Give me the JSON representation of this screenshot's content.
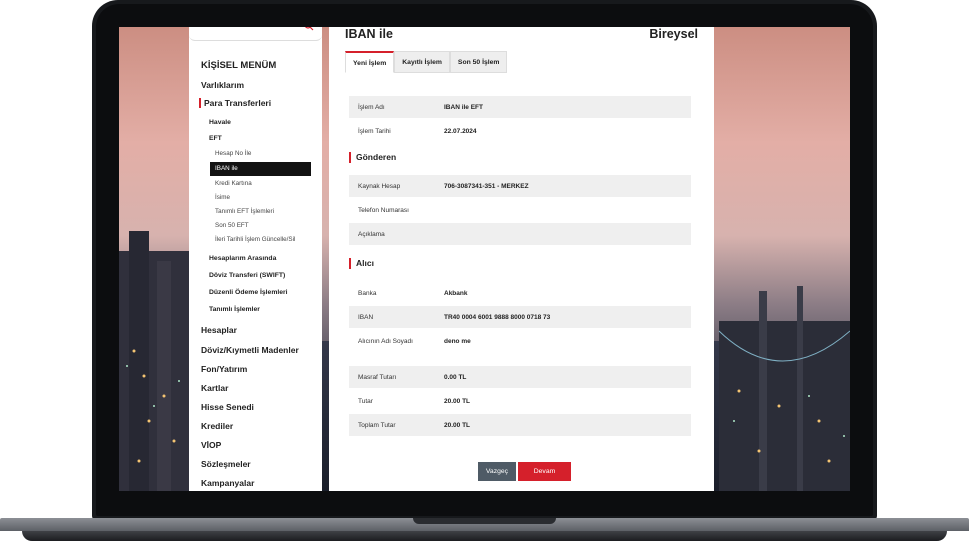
{
  "sidebar": {
    "title": "KİŞİSEL MENÜM",
    "items": [
      {
        "label": "Varlıklarım"
      },
      {
        "label": "Para Transferleri"
      }
    ],
    "para_transferleri": {
      "havale": "Havale",
      "eft": "EFT",
      "eft_items": [
        "Hesap No İle",
        "IBAN ile",
        "Kredi Kartına",
        "İsime",
        "Tanımlı EFT İşlemleri",
        "Son 50 EFT",
        "İleri Tarihli İşlem Güncelle/Sil"
      ],
      "more": [
        "Hesaplarım Arasında",
        "Döviz Transferi (SWIFT)",
        "Düzenli Ödeme İşlemleri",
        "Tanımlı İşlemler"
      ]
    },
    "main_items": [
      "Hesaplar",
      "Döviz/Kıymetli Madenler",
      "Fon/Yatırım",
      "Kartlar",
      "Hisse Senedi",
      "Krediler",
      "VİOP",
      "Sözleşmeler",
      "Kampanyalar"
    ]
  },
  "panel": {
    "title": "IBAN ile",
    "type": "Bireysel",
    "tabs": [
      "Yeni İşlem",
      "Kayıtlı İşlem",
      "Son 50 İşlem"
    ],
    "transaction_name_label": "İşlem Adı",
    "transaction_name": "IBAN ile EFT",
    "transaction_date_label": "İşlem Tarihi",
    "transaction_date": "22.07.2024",
    "sender_header": "Gönderen",
    "source_account_label": "Kaynak Hesap",
    "source_account": "706-3087341-351 - MERKEZ",
    "phone_label": "Telefon Numarası",
    "description_label": "Açıklama",
    "receiver_header": "Alıcı",
    "bank_label": "Banka",
    "bank": "Akbank",
    "iban_label": "IBAN",
    "iban": "TR40 0004 6001 9888 8000 0718 73",
    "receiver_name_label": "Alıcının Adı Soyadı",
    "receiver_name": "deno me",
    "fee_label": "Masraf Tutarı",
    "fee": "0.00 TL",
    "amount_label": "Tutar",
    "amount": "20.00 TL",
    "total_label": "Toplam Tutar",
    "total": "20.00 TL",
    "cancel_label": "Vazgeç",
    "continue_label": "Devam"
  },
  "colors": {
    "accent": "#d5202b",
    "cancel": "#4f5b66",
    "active_menu": "#121212"
  }
}
